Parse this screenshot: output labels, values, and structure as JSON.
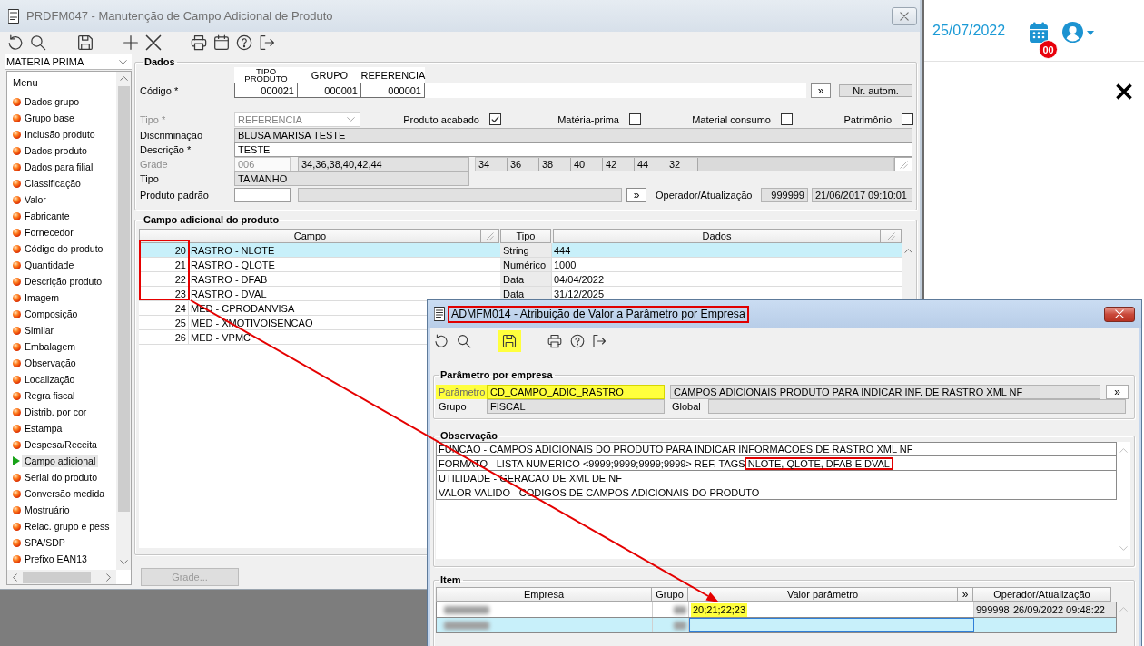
{
  "window": {
    "title": "PRDFM047 - Manutenção de Campo Adicional de Produto"
  },
  "sidebar": {
    "filter": "MATERIA PRIMA",
    "menu_title": "Menu",
    "items": [
      {
        "label": "Dados grupo",
        "selected": false
      },
      {
        "label": "Grupo base",
        "selected": false
      },
      {
        "label": "Inclusão produto",
        "selected": false
      },
      {
        "label": "Dados produto",
        "selected": false
      },
      {
        "label": "Dados para filial",
        "selected": false
      },
      {
        "label": "Classificação",
        "selected": false
      },
      {
        "label": "Valor",
        "selected": false
      },
      {
        "label": "Fabricante",
        "selected": false
      },
      {
        "label": "Fornecedor",
        "selected": false
      },
      {
        "label": "Código do produto",
        "selected": false
      },
      {
        "label": "Quantidade",
        "selected": false
      },
      {
        "label": "Descrição produto",
        "selected": false
      },
      {
        "label": "Imagem",
        "selected": false
      },
      {
        "label": "Composição",
        "selected": false
      },
      {
        "label": "Similar",
        "selected": false
      },
      {
        "label": "Embalagem",
        "selected": false
      },
      {
        "label": "Observação",
        "selected": false
      },
      {
        "label": "Localização",
        "selected": false
      },
      {
        "label": "Regra fiscal",
        "selected": false
      },
      {
        "label": "Distrib. por cor",
        "selected": false
      },
      {
        "label": "Estampa",
        "selected": false
      },
      {
        "label": "Despesa/Receita",
        "selected": false
      },
      {
        "label": "Campo adicional",
        "selected": true
      },
      {
        "label": "Serial do produto",
        "selected": false
      },
      {
        "label": "Conversão medida",
        "selected": false
      },
      {
        "label": "Mostruário",
        "selected": false
      },
      {
        "label": "Relac. grupo e pess",
        "selected": false
      },
      {
        "label": "SPA/SDP",
        "selected": false
      },
      {
        "label": "Prefixo EAN13",
        "selected": false
      }
    ]
  },
  "dados": {
    "title": "Dados",
    "codigo": {
      "label": "Código *",
      "columns": [
        "TIPO PRODUTO",
        "GRUPO",
        "REFERENCIA"
      ],
      "values": [
        "000021",
        "000001",
        "000001"
      ],
      "lookup_button": "»",
      "auto_button": "Nr. autom."
    },
    "tipo": {
      "label": "Tipo *",
      "value": "REFERENCIA",
      "disabled": true
    },
    "flags": [
      {
        "label": "Produto acabado",
        "checked": true
      },
      {
        "label": "Matéria-prima",
        "checked": false
      },
      {
        "label": "Material consumo",
        "checked": false
      },
      {
        "label": "Patrimônio",
        "checked": false
      }
    ],
    "discriminacao": {
      "label": "Discriminação",
      "value": "BLUSA MARISA TESTE",
      "readonly": true
    },
    "descricao": {
      "label": "Descrição *",
      "value": "TESTE",
      "readonly": false
    },
    "grade": {
      "label": "Grade",
      "disabled": true,
      "code": "006",
      "sizes_text": "34,36,38,40,42,44",
      "sizes": [
        "34",
        "36",
        "38",
        "40",
        "42",
        "44",
        "32"
      ]
    },
    "tipo_grade": {
      "label": "Tipo",
      "value": "TAMANHO",
      "readonly": true
    },
    "produto_padrao": {
      "label": "Produto padrão",
      "button": "»"
    },
    "operador": {
      "label": "Operador/Atualização",
      "operator": "999999",
      "updated": "21/06/2017 09:10:01"
    }
  },
  "campo_adicional": {
    "title": "Campo adicional do produto",
    "columns": [
      "Campo",
      "Tipo",
      "Dados"
    ],
    "rows": [
      {
        "code": "20",
        "name": "RASTRO - NLOTE",
        "tipo": "String",
        "dados": "444",
        "selected": true,
        "marked": true
      },
      {
        "code": "21",
        "name": "RASTRO - QLOTE",
        "tipo": "Numérico",
        "dados": "1000",
        "selected": false,
        "marked": true
      },
      {
        "code": "22",
        "name": "RASTRO - DFAB",
        "tipo": "Data",
        "dados": "04/04/2022",
        "selected": false,
        "marked": true
      },
      {
        "code": "23",
        "name": "RASTRO - DVAL",
        "tipo": "Data",
        "dados": "31/12/2025",
        "selected": false,
        "marked": true
      },
      {
        "code": "24",
        "name": "MED - CPRODANVISA",
        "selected": false,
        "marked": false
      },
      {
        "code": "25",
        "name": "MED - XMOTIVOISENCAO",
        "selected": false,
        "marked": false
      },
      {
        "code": "26",
        "name": "MED - VPMC",
        "selected": false,
        "marked": false
      }
    ]
  },
  "grade_button": {
    "label": "Grade...",
    "disabled": true
  },
  "header_panel": {
    "date": "25/07/2022",
    "calendar_badge": "00"
  },
  "dialog": {
    "title": "ADMFM014 - Atribuição de Valor a Parâmetro por Empresa",
    "title_marked": true,
    "save_highlighted": true,
    "parametro": {
      "title": "Parâmetro por empresa",
      "label": "Parâmetro",
      "value": "CD_CAMPO_ADIC_RASTRO",
      "highlighted": true,
      "description": "CAMPOS ADICIONAIS PRODUTO PARA INDICAR INF. DE RASTRO XML NF",
      "button": "»",
      "group_label": "Grupo",
      "group": "FISCAL",
      "global_label": "Global"
    },
    "observacao": {
      "title": "Observação",
      "lines": [
        {
          "text": "FUNCAO - CAMPOS ADICIONAIS DO PRODUTO PARA INDICAR INFORMACOES DE RASTRO XML NF"
        },
        {
          "text": "FORMATO - LISTA NUMERICO <9999;9999;9999;9999> REF. TAGS",
          "marked": "NLOTE, QLOTE, DFAB E DVAL"
        },
        {
          "text": "UTILIDADE - GERACAO DE XML DE NF"
        },
        {
          "text": "VALOR VALIDO - CODIGOS DE CAMPOS ADICIONAIS DO PRODUTO"
        }
      ]
    },
    "item": {
      "title": "Item",
      "columns": [
        "Empresa",
        "Grupo",
        "Valor parâmetro",
        "»",
        "Operador/Atualização"
      ],
      "rows": [
        {
          "redacted": true,
          "valor": "20;21;22;23",
          "valor_highlighted": true,
          "operator": "999998",
          "updated": "26/09/2022 09:48:22",
          "selected": false
        },
        {
          "redacted": true,
          "selected": true
        }
      ]
    }
  }
}
